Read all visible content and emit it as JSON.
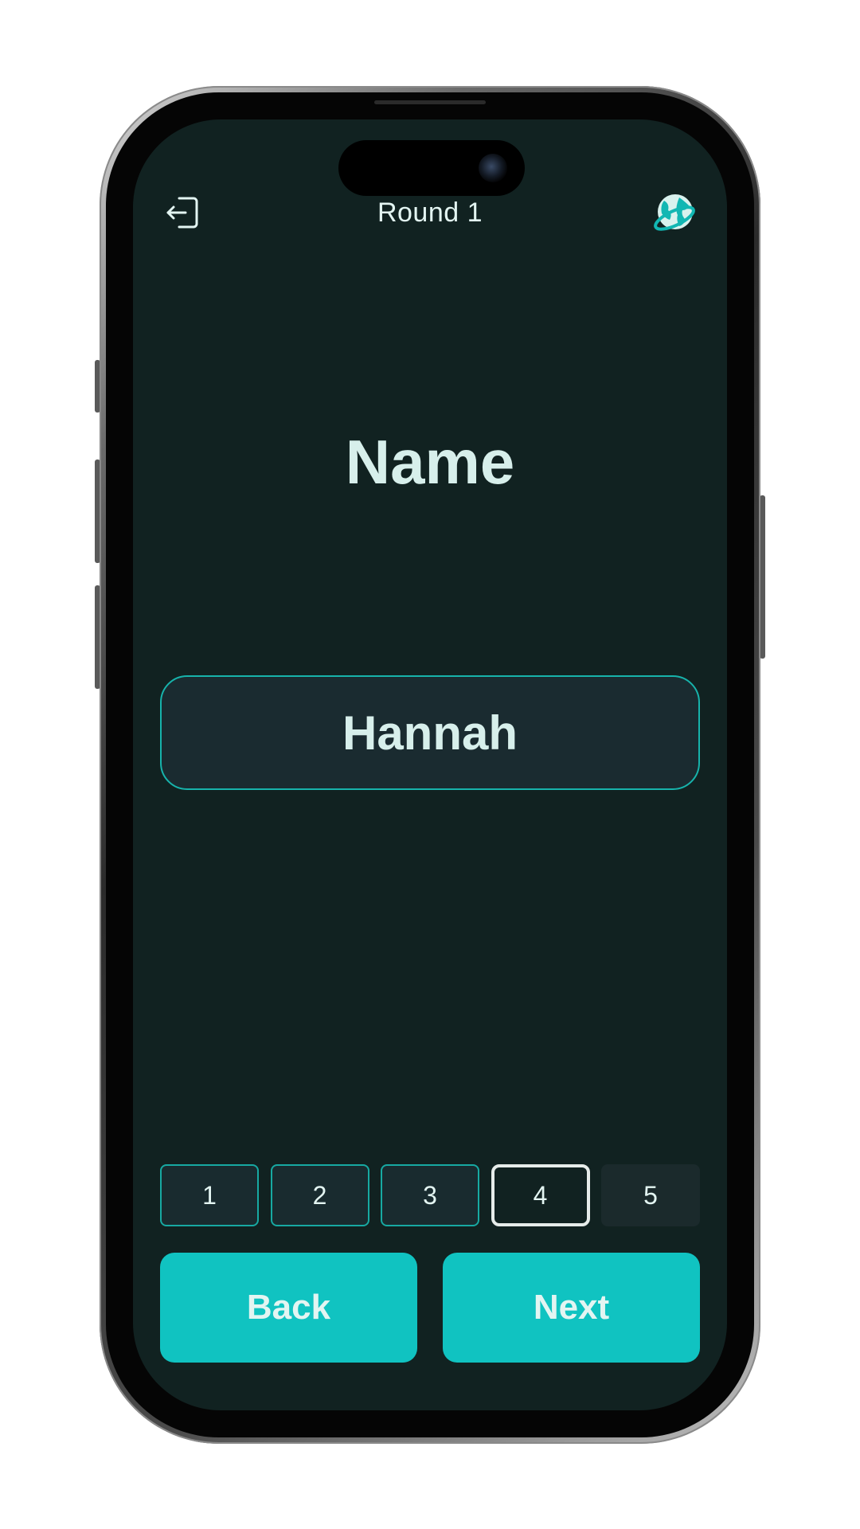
{
  "header": {
    "title": "Round 1",
    "exit_icon": "exit-door-icon",
    "globe_icon": "globe-icon"
  },
  "main": {
    "heading": "Name",
    "answer_value": "Hannah"
  },
  "pager": {
    "items": [
      {
        "label": "1",
        "state": "answered"
      },
      {
        "label": "2",
        "state": "answered"
      },
      {
        "label": "3",
        "state": "answered"
      },
      {
        "label": "4",
        "state": "current"
      },
      {
        "label": "5",
        "state": "unanswered"
      }
    ]
  },
  "actions": {
    "back_label": "Back",
    "next_label": "Next"
  },
  "colors": {
    "background": "#112221",
    "accent": "#10c3c1",
    "outline": "#17b3ab",
    "text": "#e3f5f2"
  }
}
